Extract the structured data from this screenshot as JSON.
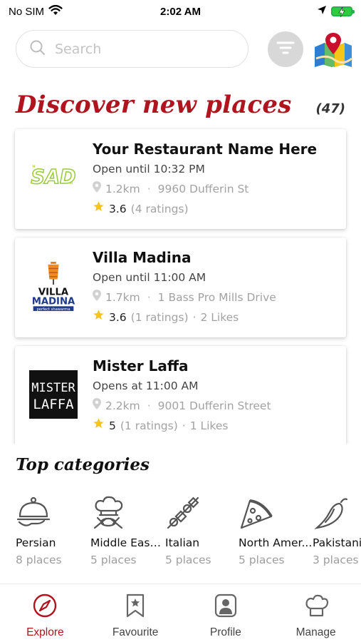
{
  "status_bar": {
    "carrier": "No SIM",
    "time": "2:02 AM"
  },
  "search": {
    "placeholder": "Search"
  },
  "discover": {
    "title": "Discover new places",
    "count": "(47)"
  },
  "restaurants": [
    {
      "name": "Your Restaurant Name Here",
      "hours": "Open until 10:32 PM",
      "distance": "1.2km",
      "address": "9960 Dufferin St",
      "rating": "3.6",
      "ratings_count": "(4 ratings)",
      "likes": "",
      "logo": "sad-logo"
    },
    {
      "name": "Villa Madina",
      "hours": "Open until 11:00 AM",
      "distance": "1.7km",
      "address": "1 Bass Pro Mills Drive",
      "rating": "3.6",
      "ratings_count": "(1 ratings)",
      "likes": "2 Likes",
      "logo": "villa-madina-logo",
      "logo_text": {
        "line1": "VILLA",
        "line2": "MADINA",
        "tag": "perfect shawarma"
      }
    },
    {
      "name": "Mister Laffa",
      "hours": "Opens at 11:00 AM",
      "distance": "2.2km",
      "address": "9001 Dufferin Street",
      "rating": "5",
      "ratings_count": "(1 ratings)",
      "likes": "1 Likes",
      "logo": "mister-laffa-logo",
      "logo_text": {
        "line1": "MISTER",
        "line2": "LAFFA"
      }
    }
  ],
  "categories_section": {
    "title": "Top categories"
  },
  "categories": [
    {
      "name": "Persian",
      "count": "8 places",
      "icon": "cloche-icon"
    },
    {
      "name": "Middle East...",
      "count": "5 places",
      "icon": "chef-hat-icon"
    },
    {
      "name": "Italian",
      "count": "5 places",
      "icon": "skewer-icon"
    },
    {
      "name": "North Amer...",
      "count": "5 places",
      "icon": "pizza-icon"
    },
    {
      "name": "Pakistani",
      "count": "3 places",
      "icon": "chili-icon"
    }
  ],
  "tabs": [
    {
      "label": "Explore",
      "icon": "compass-icon",
      "active": true
    },
    {
      "label": "Favourite",
      "icon": "bookmark-star-icon",
      "active": false
    },
    {
      "label": "Profile",
      "icon": "profile-icon",
      "active": false
    },
    {
      "label": "Manage",
      "icon": "chef-hat-icon",
      "active": false
    }
  ],
  "colors": {
    "accent": "#b0141e",
    "star": "#f5c518",
    "muted": "#a2a2a2",
    "filter_bg": "#d8d8d8",
    "battery": "#2ecc40"
  }
}
